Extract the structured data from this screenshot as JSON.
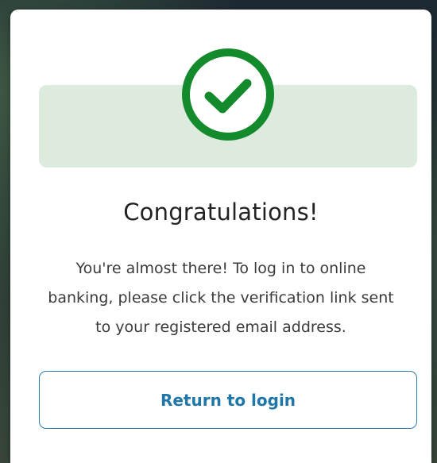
{
  "dialog": {
    "icon": "check-circle-icon",
    "icon_color": "#138a2c",
    "banner_color": "#dcebde",
    "title": "Congratulations!",
    "message_lines": [
      "You're almost there! To log in to online",
      "banking, please click the verification link sent",
      "to your registered email address."
    ],
    "button_label": "Return to login",
    "button_color": "#1f76a8"
  }
}
